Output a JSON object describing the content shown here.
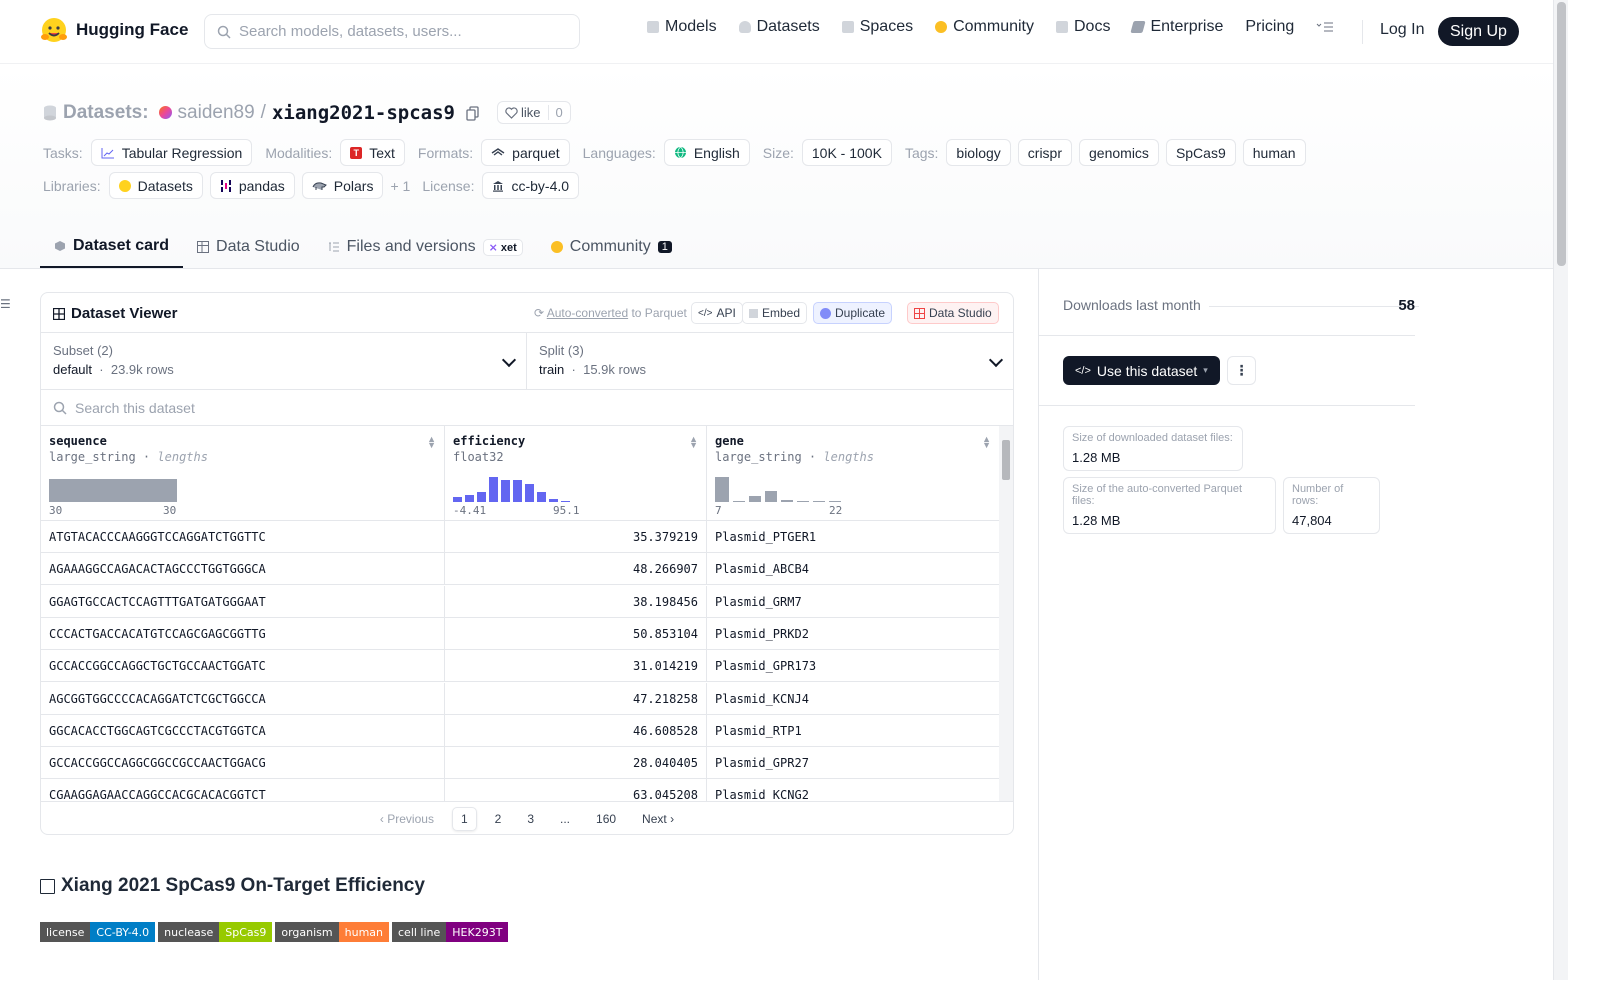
{
  "nav": {
    "brand": "Hugging Face",
    "search_placeholder": "Search models, datasets, users...",
    "links": [
      "Models",
      "Datasets",
      "Spaces",
      "Community",
      "Docs",
      "Enterprise",
      "Pricing"
    ],
    "login": "Log In",
    "signup": "Sign Up"
  },
  "repo": {
    "kind": "Datasets:",
    "owner": "saiden89",
    "sep": "/",
    "name": "xiang2021-spcas9",
    "like_label": "like",
    "like_count": "0"
  },
  "meta": {
    "tasks_label": "Tasks:",
    "tasks": [
      "Tabular Regression"
    ],
    "modalities_label": "Modalities:",
    "modalities": [
      "Text"
    ],
    "formats_label": "Formats:",
    "formats": [
      "parquet"
    ],
    "languages_label": "Languages:",
    "languages": [
      "English"
    ],
    "size_label": "Size:",
    "size": "10K - 100K",
    "tags_label": "Tags:",
    "tags": [
      "biology",
      "crispr",
      "genomics",
      "SpCas9",
      "human"
    ],
    "libraries_label": "Libraries:",
    "libraries": [
      "Datasets",
      "pandas",
      "Polars"
    ],
    "libraries_more": "+ 1",
    "license_label": "License:",
    "license": "cc-by-4.0"
  },
  "tabs": {
    "card": "Dataset card",
    "studio": "Data Studio",
    "files": "Files and versions",
    "xet": "xet",
    "community": "Community",
    "community_count": "1"
  },
  "viewer": {
    "title": "Dataset Viewer",
    "auto_converted": "Auto-converted",
    "to_parquet": "to Parquet",
    "api": "API",
    "embed": "Embed",
    "duplicate": "Duplicate",
    "data_studio": "Data Studio",
    "subset_label": "Subset (2)",
    "subset_value": "default",
    "subset_rows": "23.9k rows",
    "split_label": "Split (3)",
    "split_value": "train",
    "split_rows": "15.9k rows",
    "search_placeholder": "Search this dataset",
    "columns": [
      {
        "name": "sequence",
        "type": "large_string",
        "stat": "lengths",
        "min": "30",
        "max": "30"
      },
      {
        "name": "efficiency",
        "type": "float32",
        "stat": "",
        "min": "-4.41",
        "max": "95.1"
      },
      {
        "name": "gene",
        "type": "large_string",
        "stat": "lengths",
        "min": "7",
        "max": "22"
      }
    ],
    "rows": [
      [
        "ATGTACACCCAAGGGTCCAGGATCTGGTTC",
        "35.379219",
        "Plasmid_PTGER1"
      ],
      [
        "AGAAAGGCCAGACACTAGCCCTGGTGGGCA",
        "48.266907",
        "Plasmid_ABCB4"
      ],
      [
        "GGAGTGCCACTCCAGTTTGATGATGGGAAT",
        "38.198456",
        "Plasmid_GRM7"
      ],
      [
        "CCCACTGACCACATGTCCAGCGAGCGGTTG",
        "50.853104",
        "Plasmid_PRKD2"
      ],
      [
        "GCCACCGGCCAGGCTGCTGCCAACTGGATC",
        "31.014219",
        "Plasmid_GPR173"
      ],
      [
        "AGCGGTGGCCCCACAGGATCTCGCTGGCCA",
        "47.218258",
        "Plasmid_KCNJ4"
      ],
      [
        "GGCACACCTGGCAGTCGCCCTACGTGGTCA",
        "46.608528",
        "Plasmid_RTP1"
      ],
      [
        "GCCACCGGCCAGGCGGCCGCCAACTGGACG",
        "28.040405",
        "Plasmid_GPR27"
      ],
      [
        "CGAAGGAGAACCAGGCCACGCACACGGTCT",
        "63.045208",
        "Plasmid_KCNG2"
      ]
    ],
    "pager": {
      "prev": "Previous",
      "pages": [
        "1",
        "2",
        "3",
        "...",
        "160"
      ],
      "next": "Next"
    }
  },
  "card": {
    "title": "Xiang 2021 SpCas9 On-Target Efficiency",
    "badges": [
      {
        "k": "license",
        "v": "CC-BY-4.0",
        "color": "#007ec6"
      },
      {
        "k": "nuclease",
        "v": "SpCas9",
        "color": "#97ca00"
      },
      {
        "k": "organism",
        "v": "human",
        "color": "#fe7d37"
      },
      {
        "k": "cell line",
        "v": "HEK293T",
        "color": "#800080"
      }
    ]
  },
  "sidebar": {
    "downloads_label": "Downloads last month",
    "downloads_value": "58",
    "use_dataset": "Use this dataset",
    "dl_size_label": "Size of downloaded dataset files:",
    "dl_size": "1.28 MB",
    "parquet_size_label": "Size of the auto-converted Parquet files:",
    "parquet_size": "1.28 MB",
    "rows_label": "Number of rows:",
    "rows_value": "47,804"
  }
}
